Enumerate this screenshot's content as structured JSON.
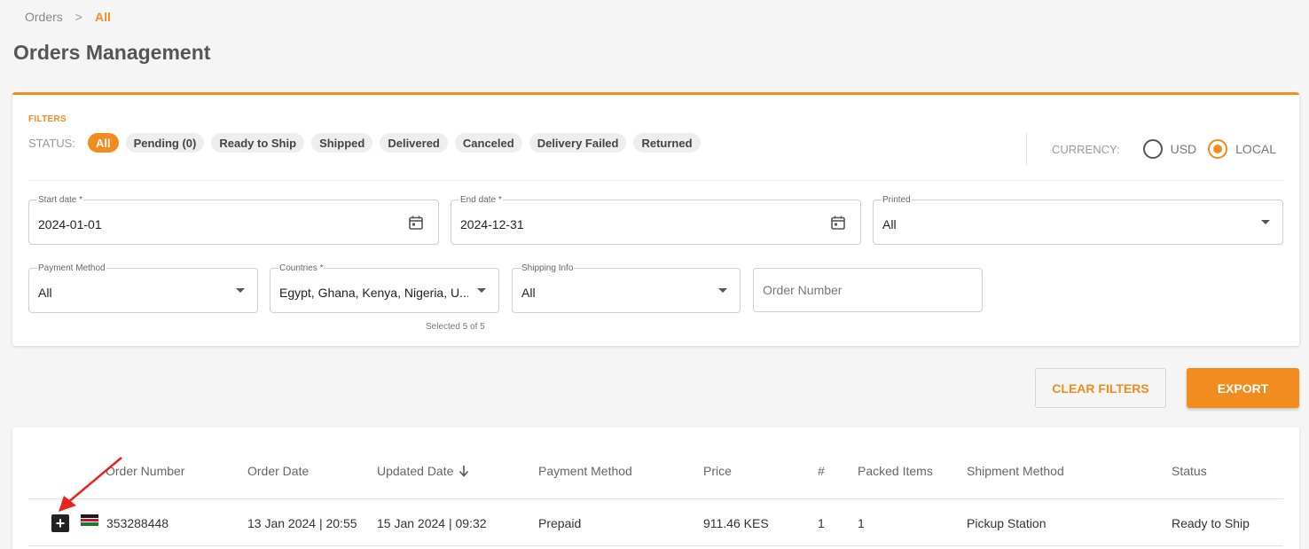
{
  "breadcrumb": {
    "parent": "Orders",
    "separator": ">",
    "current": "All"
  },
  "page": {
    "title": "Orders Management"
  },
  "filters": {
    "section_label": "FILTERS",
    "status_label": "STATUS:",
    "statuses": [
      "All",
      "Pending (0)",
      "Ready to Ship",
      "Shipped",
      "Delivered",
      "Canceled",
      "Delivery Failed",
      "Returned"
    ],
    "active_status": "All",
    "currency": {
      "label": "CURRENCY:",
      "options": [
        "USD",
        "LOCAL"
      ],
      "selected": "LOCAL"
    },
    "start_date": {
      "label": "Start date *",
      "value": "2024-01-01"
    },
    "end_date": {
      "label": "End date *",
      "value": "2024-12-31"
    },
    "printed": {
      "label": "Printed",
      "value": "All"
    },
    "payment_method": {
      "label": "Payment Method",
      "value": "All"
    },
    "countries": {
      "label": "Countries *",
      "value": "Egypt, Ghana, Kenya, Nigeria, U...",
      "helper": "Selected 5 of 5"
    },
    "shipping_info": {
      "label": "Shipping Info",
      "value": "All"
    },
    "order_number": {
      "placeholder": "Order Number"
    }
  },
  "actions": {
    "clear_filters": "CLEAR FILTERS",
    "export": "EXPORT"
  },
  "table": {
    "columns": [
      "Order Number",
      "Order Date",
      "Updated Date",
      "Payment Method",
      "Price",
      "#",
      "Packed Items",
      "Shipment Method",
      "Status"
    ],
    "sorted_column": "Updated Date",
    "rows": [
      {
        "order_number": "353288448",
        "order_date": "13 Jan 2024 | 20:55",
        "updated_date": "15 Jan 2024 | 09:32",
        "payment_method": "Prepaid",
        "price": "911.46 KES",
        "count": "1",
        "packed_items": "1",
        "shipment_method": "Pickup Station",
        "status": "Ready to Ship",
        "country_flag": "kenya-flag-icon"
      }
    ]
  },
  "colors": {
    "accent": "#f28c1e",
    "annotation_arrow": "#e8231e"
  }
}
